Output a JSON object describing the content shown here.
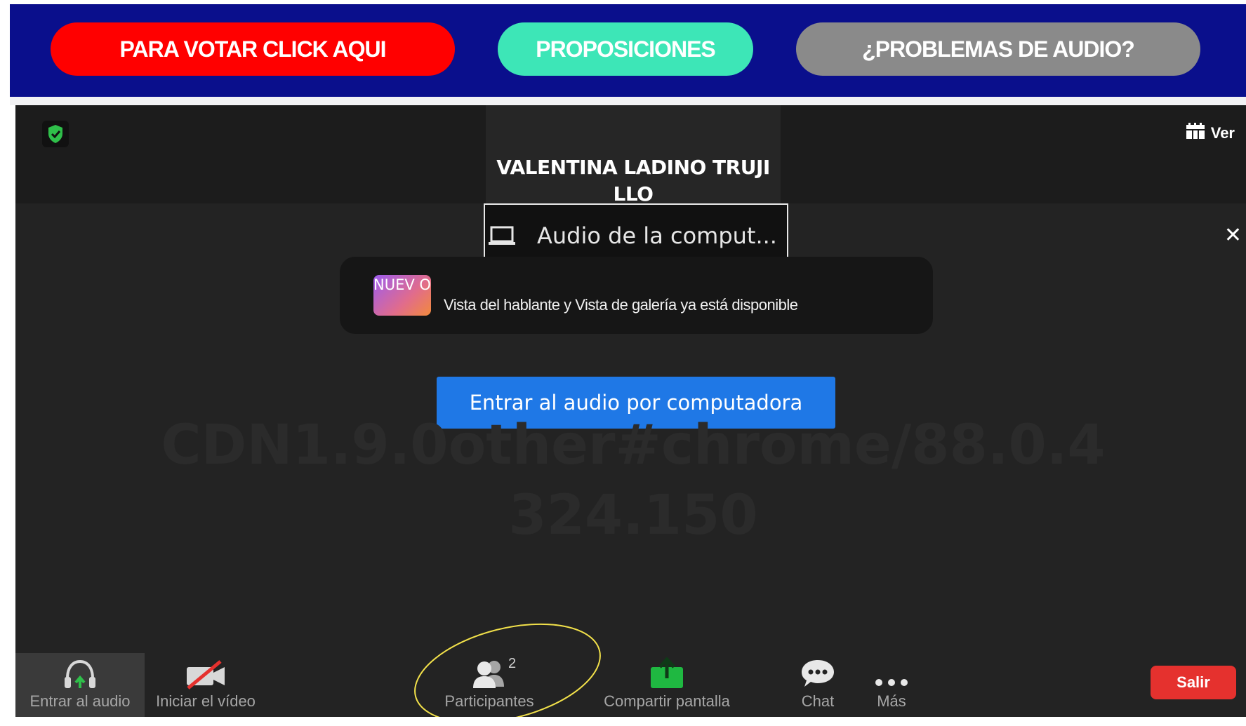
{
  "banner": {
    "vote_button": "PARA VOTAR CLICK AQUI",
    "proposals_button": "PROPOSICIONES",
    "audio_problems_button": "¿PROBLEMAS DE AUDIO?"
  },
  "meeting": {
    "view_label": "Ver",
    "speaker_name": "VALENTINA LADINO TRUJI LLO",
    "audio_tooltip": "Audio de la comput...",
    "notice": {
      "badge": "NUEV O",
      "text": "Vista del hablante y Vista de galería ya está disponible"
    },
    "join_audio_button": "Entrar al audio por computadora",
    "watermark": "CDN1.9.0other#chrome/88.0.4 324.150"
  },
  "toolbar": {
    "audio": "Entrar al audio",
    "video": "Iniciar el vídeo",
    "participants": "Participantes",
    "participant_count": "2",
    "share": "Compartir pantalla",
    "chat": "Chat",
    "more": "Más",
    "leave": "Salir"
  },
  "colors": {
    "banner_bg": "#0a0f8c",
    "vote_red": "#ff0000",
    "proposals_teal": "#3de6b7",
    "audio_gray": "#8a8a8a",
    "join_blue": "#1f78e6",
    "leave_red": "#e5312e",
    "annotation_yellow": "#f2e14a"
  },
  "icons": [
    "shield-icon",
    "calendar-grid-icon",
    "laptop-icon",
    "close-icon",
    "headphones-icon",
    "video-off-icon",
    "participants-icon",
    "share-screen-icon",
    "chat-bubble-icon",
    "more-dots-icon"
  ]
}
